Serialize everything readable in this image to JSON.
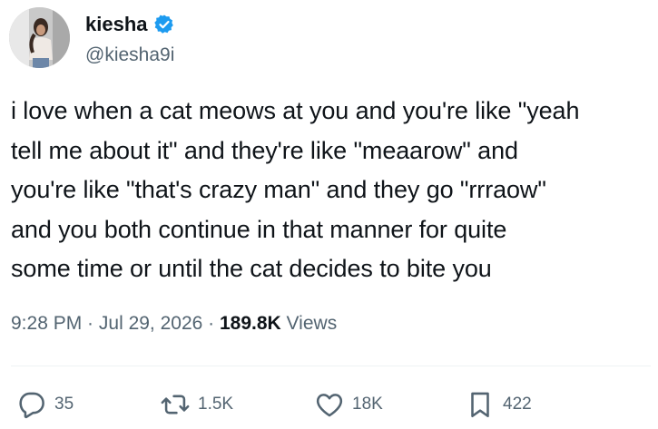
{
  "author": {
    "display_name": "kiesha",
    "handle": "@kiesha9i",
    "verified": true,
    "verified_color": "#1d9bf0"
  },
  "tweet": {
    "text": "i love when a cat meows at you and you're like \"yeah\ntell me about it\" and they're like \"meaarow\" and\nyou're like \"that's crazy man\" and they go \"rrraow\"\nand you both continue in that manner for quite\nsome time or until the cat decides to bite you"
  },
  "meta": {
    "time": "9:28 PM",
    "separator": " · ",
    "date": "Jul 29, 2026",
    "views_count": "189.8K",
    "views_label": " Views"
  },
  "actions": {
    "reply": {
      "icon": "reply-icon",
      "count": "35"
    },
    "retweet": {
      "icon": "retweet-icon",
      "count": "1.5K"
    },
    "like": {
      "icon": "heart-icon",
      "count": "18K"
    },
    "bookmark": {
      "icon": "bookmark-icon",
      "count": "422"
    }
  },
  "colors": {
    "text": "#0f1419",
    "secondary": "#536471",
    "divider": "#eff3f4"
  }
}
